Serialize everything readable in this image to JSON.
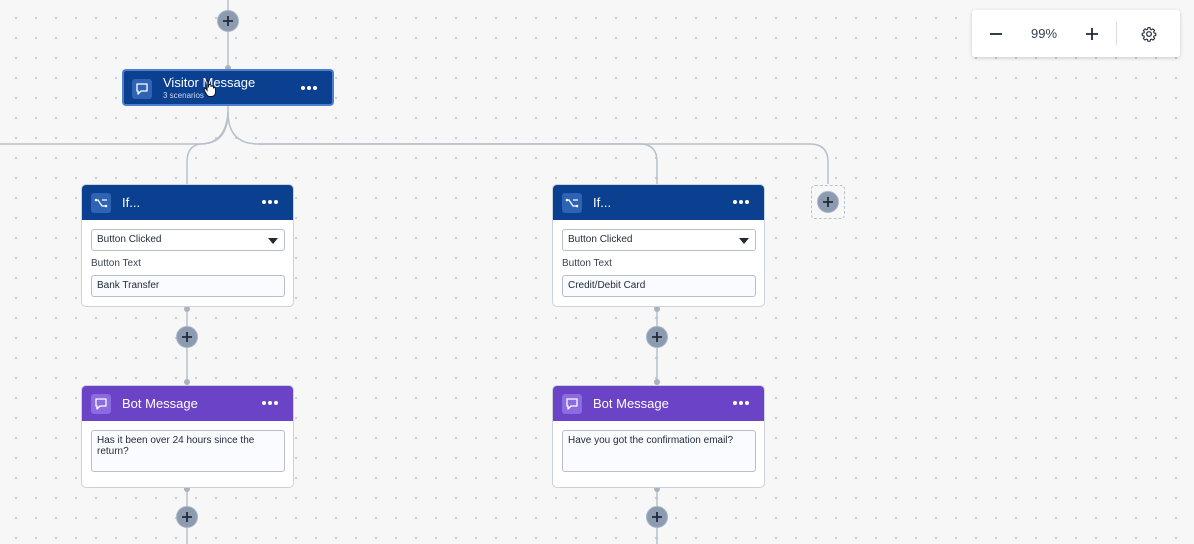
{
  "zoom": {
    "level": "99%"
  },
  "visitor_node": {
    "title": "Visitor Message",
    "subtitle": "3 scenarios"
  },
  "branches": [
    {
      "condition": {
        "title": "If...",
        "select_value": "Button Clicked",
        "field_label": "Button Text",
        "field_value": "Bank Transfer"
      },
      "bot": {
        "title": "Bot Message",
        "message": "Has it been over 24 hours since the return?"
      }
    },
    {
      "condition": {
        "title": "If...",
        "select_value": "Button Clicked",
        "field_label": "Button Text",
        "field_value": "Credit/Debit Card"
      },
      "bot": {
        "title": "Bot Message",
        "message": "Have you got the confirmation email?"
      }
    }
  ],
  "colors": {
    "condition_header": "#0b3f8f",
    "bot_header": "#6a43c7",
    "canvas_background": "#f7f7f8",
    "connector": "#aab3bf"
  },
  "icons": [
    "minus-icon",
    "plus-icon",
    "gear-icon",
    "chat-bubble-icon",
    "branch-icon",
    "more-icon",
    "chevron-down-icon",
    "cursor-hand-icon"
  ]
}
